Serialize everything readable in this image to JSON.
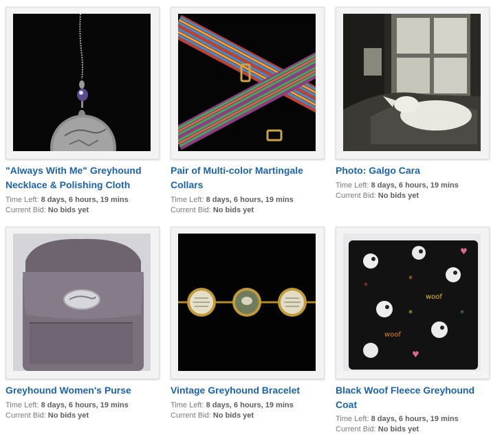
{
  "listings": [
    {
      "title": "\"Always With Me\" Greyhound Necklace & Polishing Cloth",
      "image": "greyhound-necklace-photo",
      "time_left_label": "Time Left:",
      "time_left": "8 days, 6 hours, 19 mins",
      "bid_label": "Current Bid:",
      "bid": "No bids yet"
    },
    {
      "title": "Pair of Multi-color Martingale Collars",
      "image": "martingale-collars-photo",
      "time_left_label": "Time Left:",
      "time_left": "8 days, 6 hours, 19 mins",
      "bid_label": "Current Bid:",
      "bid": "No bids yet"
    },
    {
      "title": "Photo: Galgo Cara",
      "image": "galgo-on-couch-photo",
      "time_left_label": "Time Left:",
      "time_left": "8 days, 6 hours, 19 mins",
      "bid_label": "Current Bid:",
      "bid": "No bids yet"
    },
    {
      "title": "Greyhound Women's Purse",
      "image": "purse-photo",
      "time_left_label": "Time Left:",
      "time_left": "8 days, 6 hours, 19 mins",
      "bid_label": "Current Bid:",
      "bid": "No bids yet"
    },
    {
      "title": "Vintage Greyhound Bracelet",
      "image": "bracelet-photo",
      "time_left_label": "Time Left:",
      "time_left": "8 days, 6 hours, 19 mins",
      "bid_label": "Current Bid:",
      "bid": "No bids yet"
    },
    {
      "title": "Black Woof Fleece Greyhound Coat",
      "image": "fleece-coat-photo",
      "time_left_label": "Time Left:",
      "time_left": "8 days, 6 hours, 19 mins",
      "bid_label": "Current Bid:",
      "bid": "No bids yet"
    }
  ],
  "colors": {
    "link": "#1d63a6",
    "meta_text": "#7a7a7a",
    "meta_value": "#5e5e5e",
    "frame_bg": "#f3f3f3"
  }
}
